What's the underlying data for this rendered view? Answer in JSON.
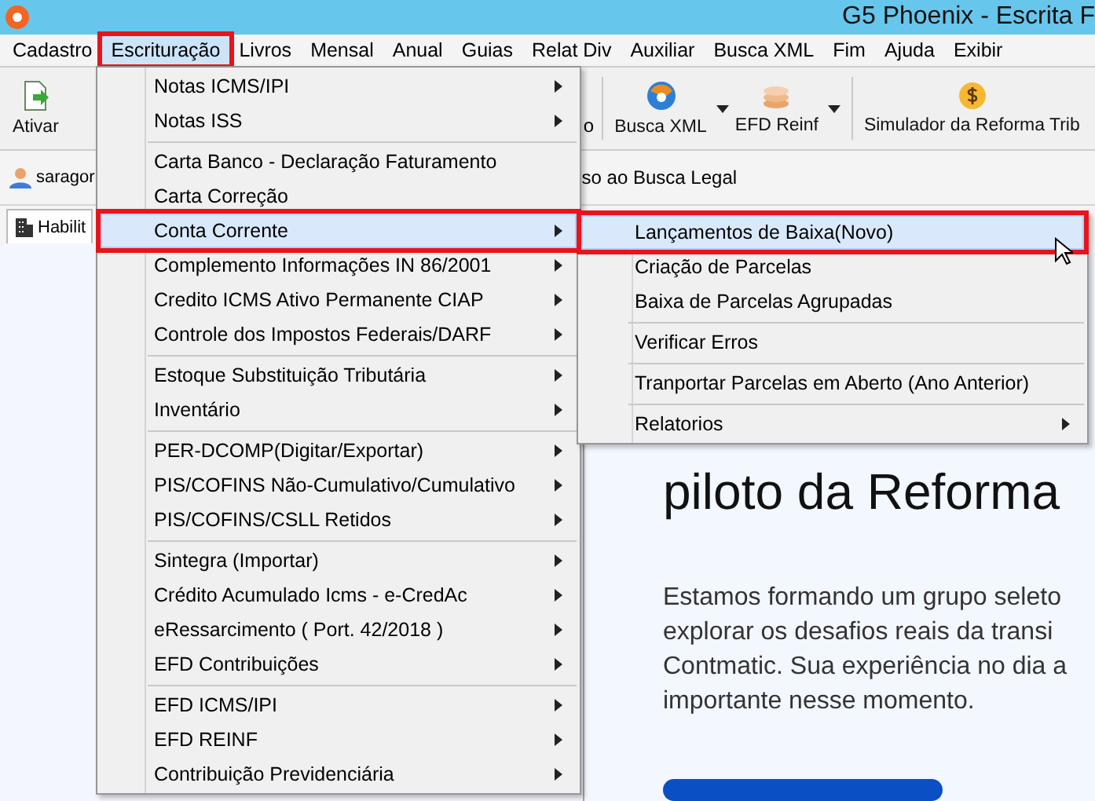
{
  "window": {
    "title": "G5 Phoenix - Escrita F"
  },
  "menubar": [
    {
      "label": "Cadastro",
      "selected": false,
      "highlighted": false
    },
    {
      "label": "Escrituração",
      "selected": true,
      "highlighted": true
    },
    {
      "label": "Livros",
      "selected": false,
      "highlighted": false
    },
    {
      "label": "Mensal",
      "selected": false,
      "highlighted": false
    },
    {
      "label": "Anual",
      "selected": false,
      "highlighted": false
    },
    {
      "label": "Guias",
      "selected": false,
      "highlighted": false
    },
    {
      "label": "Relat Div",
      "selected": false,
      "highlighted": false
    },
    {
      "label": "Auxiliar",
      "selected": false,
      "highlighted": false
    },
    {
      "label": "Busca XML",
      "selected": false,
      "highlighted": false
    },
    {
      "label": "Fim",
      "selected": false,
      "highlighted": false
    },
    {
      "label": "Ajuda",
      "selected": false,
      "highlighted": false
    },
    {
      "label": "Exibir",
      "selected": false,
      "highlighted": false
    }
  ],
  "toolbar": [
    {
      "kind": "activate",
      "label": "Ativar",
      "dropdown": false
    },
    {
      "kind": "plain",
      "label": "o"
    },
    {
      "kind": "globe",
      "label": "Busca XML",
      "dropdown": true
    },
    {
      "kind": "coins",
      "label": "EFD Reinf",
      "dropdown": true
    },
    {
      "kind": "dollar",
      "label": "Simulador da Reforma Trib",
      "dropdown": false
    }
  ],
  "user_bar": {
    "user": "saragor",
    "notice": "so ao Busca Legal"
  },
  "tab": {
    "label": "Habilit"
  },
  "content": {
    "heading": "piloto da Reforma",
    "paragraph": [
      "Estamos formando um grupo seleto",
      "explorar os desafios reais da transi",
      "Contmatic. Sua experiência no dia a",
      "importante nesse momento."
    ]
  },
  "menu": {
    "groups": [
      [
        {
          "label": "Notas ICMS/IPI",
          "arrow": true,
          "selected": false,
          "highlighted": false
        },
        {
          "label": "Notas ISS",
          "arrow": true,
          "selected": false,
          "highlighted": false
        }
      ],
      [
        {
          "label": "Carta Banco - Declaração Faturamento",
          "arrow": false,
          "selected": false,
          "highlighted": false
        },
        {
          "label": "Carta Correção",
          "arrow": false,
          "selected": false,
          "highlighted": false
        },
        {
          "label": "Conta Corrente",
          "arrow": true,
          "selected": true,
          "highlighted": true
        },
        {
          "label": "Complemento Informações IN 86/2001",
          "arrow": true,
          "selected": false,
          "highlighted": false
        },
        {
          "label": "Credito ICMS Ativo Permanente CIAP",
          "arrow": true,
          "selected": false,
          "highlighted": false
        },
        {
          "label": "Controle dos Impostos Federais/DARF",
          "arrow": true,
          "selected": false,
          "highlighted": false
        }
      ],
      [
        {
          "label": "Estoque Substituição Tributária",
          "arrow": true,
          "selected": false,
          "highlighted": false
        },
        {
          "label": "Inventário",
          "arrow": true,
          "selected": false,
          "highlighted": false
        }
      ],
      [
        {
          "label": "PER-DCOMP(Digitar/Exportar)",
          "arrow": true,
          "selected": false,
          "highlighted": false
        },
        {
          "label": "PIS/COFINS Não-Cumulativo/Cumulativo",
          "arrow": true,
          "selected": false,
          "highlighted": false
        },
        {
          "label": "PIS/COFINS/CSLL Retidos",
          "arrow": true,
          "selected": false,
          "highlighted": false
        }
      ],
      [
        {
          "label": "Sintegra (Importar)",
          "arrow": true,
          "selected": false,
          "highlighted": false
        },
        {
          "label": "Crédito Acumulado Icms - e-CredAc",
          "arrow": true,
          "selected": false,
          "highlighted": false
        },
        {
          "label": "eRessarcimento ( Port. 42/2018 )",
          "arrow": true,
          "selected": false,
          "highlighted": false
        },
        {
          "label": "EFD Contribuições",
          "arrow": true,
          "selected": false,
          "highlighted": false
        }
      ],
      [
        {
          "label": "EFD ICMS/IPI",
          "arrow": true,
          "selected": false,
          "highlighted": false
        },
        {
          "label": "EFD REINF",
          "arrow": true,
          "selected": false,
          "highlighted": false
        },
        {
          "label": "Contribuição Previdenciária",
          "arrow": true,
          "selected": false,
          "highlighted": false
        }
      ]
    ]
  },
  "submenu": {
    "groups": [
      [
        {
          "label": "Lançamentos de Baixa(Novo)",
          "arrow": false,
          "selected": true,
          "highlighted": true
        },
        {
          "label": "Criação de Parcelas",
          "arrow": false,
          "selected": false,
          "highlighted": false
        },
        {
          "label": "Baixa de Parcelas Agrupadas",
          "arrow": false,
          "selected": false,
          "highlighted": false
        }
      ],
      [
        {
          "label": "Verificar Erros",
          "arrow": false,
          "selected": false,
          "highlighted": false
        }
      ],
      [
        {
          "label": "Tranportar Parcelas em Aberto (Ano Anterior)",
          "arrow": false,
          "selected": false,
          "highlighted": false
        }
      ],
      [
        {
          "label": "Relatorios",
          "arrow": true,
          "selected": false,
          "highlighted": false
        }
      ]
    ]
  }
}
